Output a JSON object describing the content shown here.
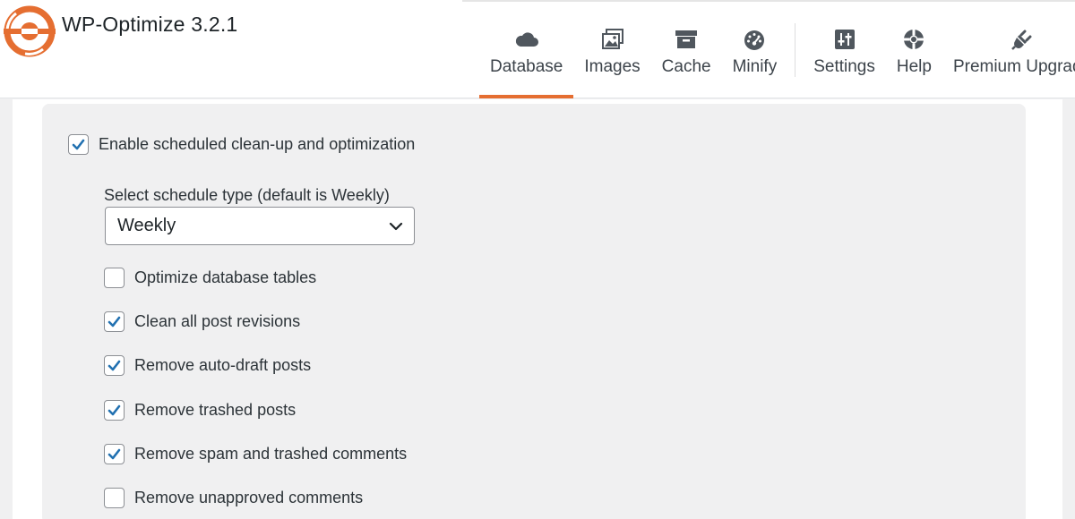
{
  "app": {
    "title": "WP-Optimize 3.2.1",
    "accent_color": "#e56e31",
    "logo_icon": "wp-optimize-logo"
  },
  "nav": {
    "tabs": [
      {
        "label": "Database",
        "icon": "cloud-icon",
        "active": true
      },
      {
        "label": "Images",
        "icon": "images-icon",
        "active": false
      },
      {
        "label": "Cache",
        "icon": "archive-icon",
        "active": false
      },
      {
        "label": "Minify",
        "icon": "dashboard-icon",
        "active": false
      },
      {
        "label": "Settings",
        "icon": "sliders-icon",
        "active": false
      },
      {
        "label": "Help",
        "icon": "lifebuoy-icon",
        "active": false
      },
      {
        "label": "Premium Upgrade",
        "icon": "plug-icon",
        "active": false
      }
    ]
  },
  "schedule": {
    "enable_label": "Enable scheduled clean-up and optimization",
    "enable_checked": true,
    "type_label": "Select schedule type (default is Weekly)",
    "type_value": "Weekly",
    "options": [
      {
        "label": "Optimize database tables",
        "checked": false
      },
      {
        "label": "Clean all post revisions",
        "checked": true
      },
      {
        "label": "Remove auto-draft posts",
        "checked": true
      },
      {
        "label": "Remove trashed posts",
        "checked": true
      },
      {
        "label": "Remove spam and trashed comments",
        "checked": true
      },
      {
        "label": "Remove unapproved comments",
        "checked": false
      }
    ]
  },
  "colors": {
    "checkmark": "#2271b1",
    "panel_bg": "#f0f0f1"
  }
}
